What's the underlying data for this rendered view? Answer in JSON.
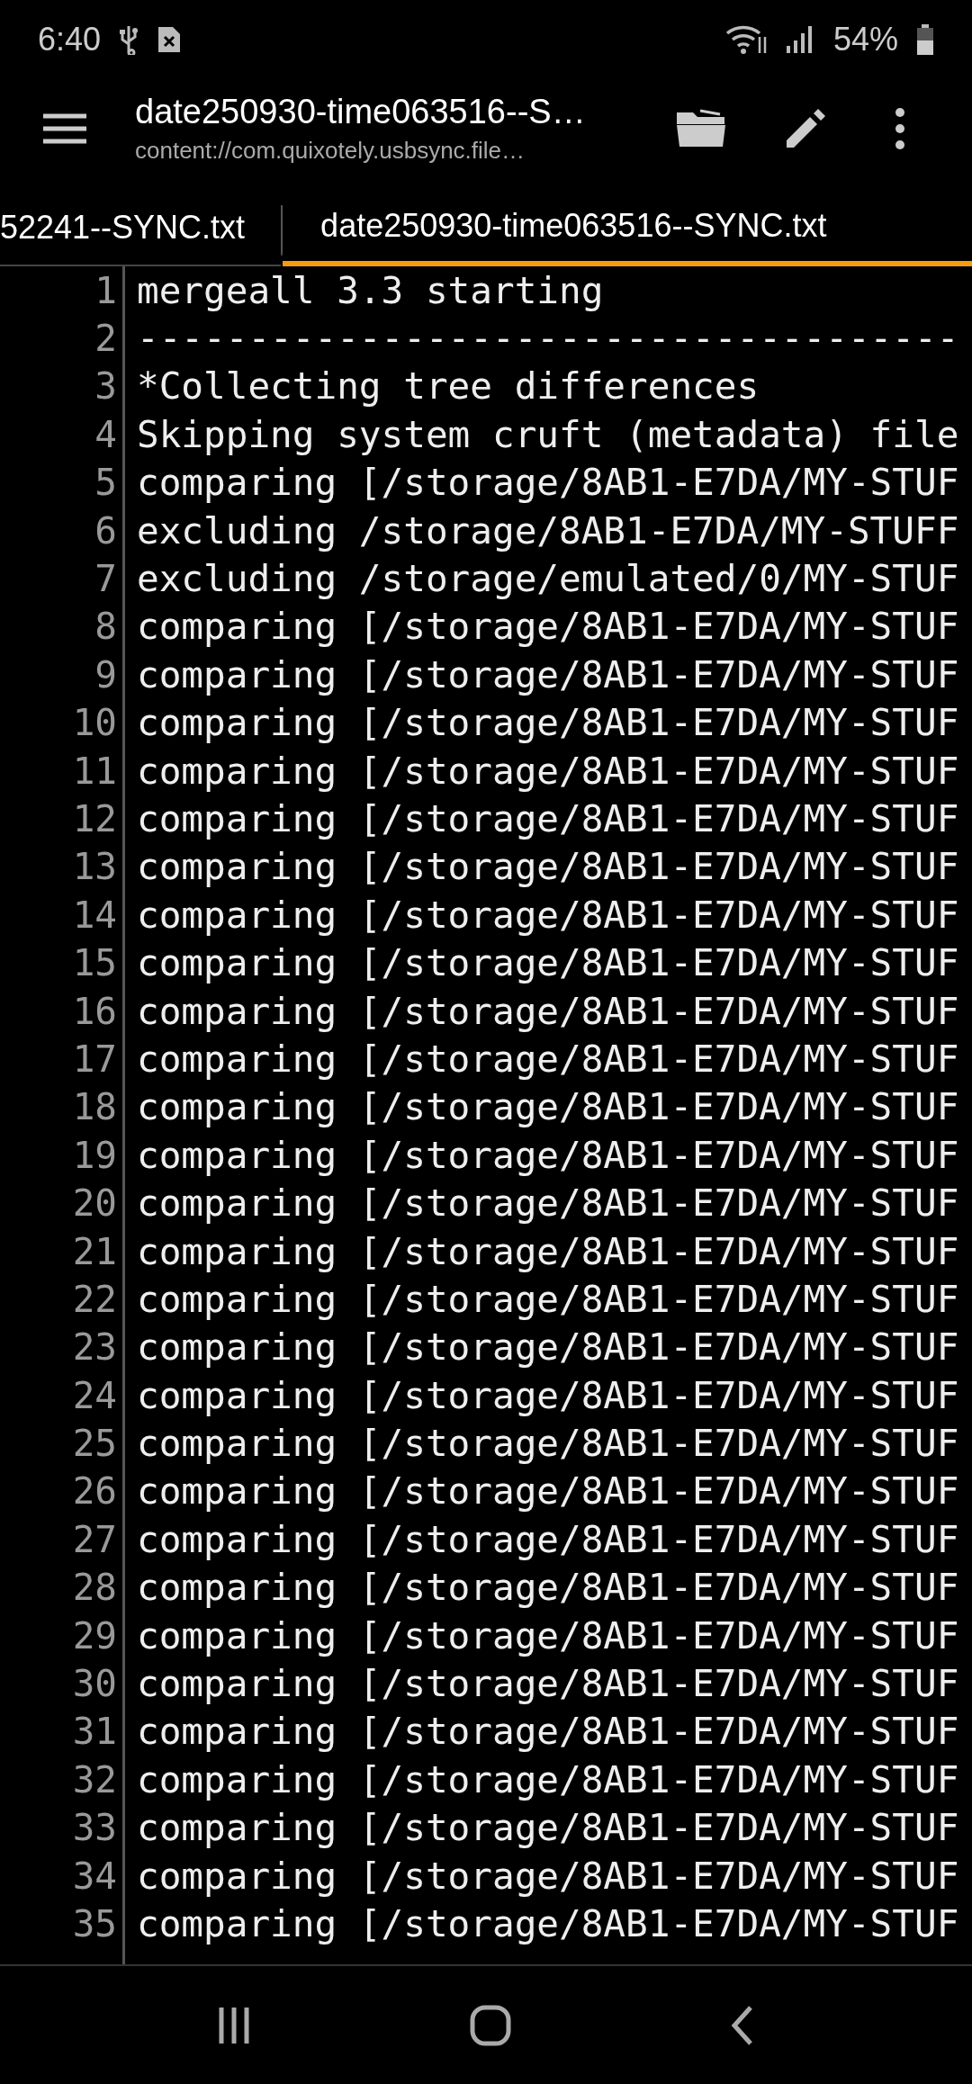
{
  "status_bar": {
    "time": "6:40",
    "battery": "54%"
  },
  "toolbar": {
    "title": "date250930-time063516--S…",
    "subtitle": "content://com.quixotely.usbsync.file…"
  },
  "tabs": [
    {
      "label": "52241--SYNC.txt",
      "selected": false
    },
    {
      "label": "date250930-time063516--SYNC.txt",
      "selected": true
    }
  ],
  "editor": {
    "lines": [
      {
        "number": "1",
        "text": "mergeall 3.3 starting"
      },
      {
        "number": "2",
        "text": "-------------------------------------"
      },
      {
        "number": "3",
        "text": "*Collecting tree differences"
      },
      {
        "number": "4",
        "text": "Skipping system cruft (metadata) file"
      },
      {
        "number": "5",
        "text": "comparing [/storage/8AB1-E7DA/MY-STUF"
      },
      {
        "number": "6",
        "text": "excluding /storage/8AB1-E7DA/MY-STUFF"
      },
      {
        "number": "7",
        "text": "excluding /storage/emulated/0/MY-STUF"
      },
      {
        "number": "8",
        "text": "comparing [/storage/8AB1-E7DA/MY-STUF"
      },
      {
        "number": "9",
        "text": "comparing [/storage/8AB1-E7DA/MY-STUF"
      },
      {
        "number": "10",
        "text": "comparing [/storage/8AB1-E7DA/MY-STUF"
      },
      {
        "number": "11",
        "text": "comparing [/storage/8AB1-E7DA/MY-STUF"
      },
      {
        "number": "12",
        "text": "comparing [/storage/8AB1-E7DA/MY-STUF"
      },
      {
        "number": "13",
        "text": "comparing [/storage/8AB1-E7DA/MY-STUF"
      },
      {
        "number": "14",
        "text": "comparing [/storage/8AB1-E7DA/MY-STUF"
      },
      {
        "number": "15",
        "text": "comparing [/storage/8AB1-E7DA/MY-STUF"
      },
      {
        "number": "16",
        "text": "comparing [/storage/8AB1-E7DA/MY-STUF"
      },
      {
        "number": "17",
        "text": "comparing [/storage/8AB1-E7DA/MY-STUF"
      },
      {
        "number": "18",
        "text": "comparing [/storage/8AB1-E7DA/MY-STUF"
      },
      {
        "number": "19",
        "text": "comparing [/storage/8AB1-E7DA/MY-STUF"
      },
      {
        "number": "20",
        "text": "comparing [/storage/8AB1-E7DA/MY-STUF"
      },
      {
        "number": "21",
        "text": "comparing [/storage/8AB1-E7DA/MY-STUF"
      },
      {
        "number": "22",
        "text": "comparing [/storage/8AB1-E7DA/MY-STUF"
      },
      {
        "number": "23",
        "text": "comparing [/storage/8AB1-E7DA/MY-STUF"
      },
      {
        "number": "24",
        "text": "comparing [/storage/8AB1-E7DA/MY-STUF"
      },
      {
        "number": "25",
        "text": "comparing [/storage/8AB1-E7DA/MY-STUF"
      },
      {
        "number": "26",
        "text": "comparing [/storage/8AB1-E7DA/MY-STUF"
      },
      {
        "number": "27",
        "text": "comparing [/storage/8AB1-E7DA/MY-STUF"
      },
      {
        "number": "28",
        "text": "comparing [/storage/8AB1-E7DA/MY-STUF"
      },
      {
        "number": "29",
        "text": "comparing [/storage/8AB1-E7DA/MY-STUF"
      },
      {
        "number": "30",
        "text": "comparing [/storage/8AB1-E7DA/MY-STUF"
      },
      {
        "number": "31",
        "text": "comparing [/storage/8AB1-E7DA/MY-STUF"
      },
      {
        "number": "32",
        "text": "comparing [/storage/8AB1-E7DA/MY-STUF"
      },
      {
        "number": "33",
        "text": "comparing [/storage/8AB1-E7DA/MY-STUF"
      },
      {
        "number": "34",
        "text": "comparing [/storage/8AB1-E7DA/MY-STUF"
      },
      {
        "number": "35",
        "text": "comparing [/storage/8AB1-E7DA/MY-STUF"
      }
    ]
  }
}
